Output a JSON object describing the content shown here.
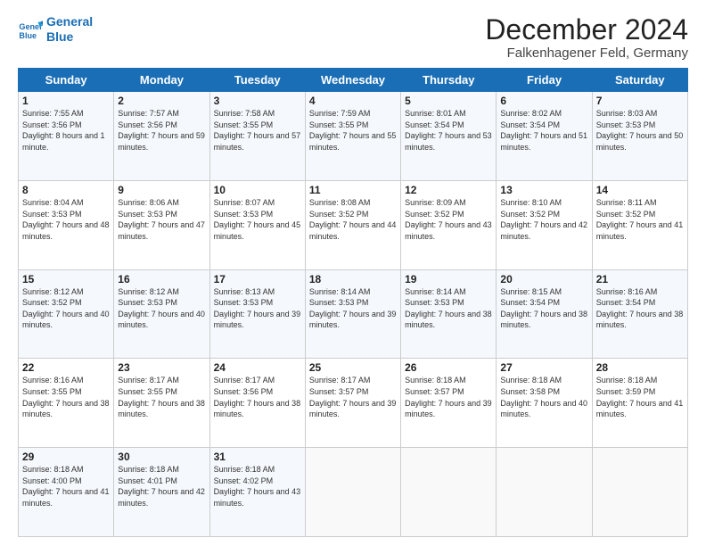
{
  "logo": {
    "line1": "General",
    "line2": "Blue"
  },
  "title": "December 2024",
  "subtitle": "Falkenhagener Feld, Germany",
  "days_header": [
    "Sunday",
    "Monday",
    "Tuesday",
    "Wednesday",
    "Thursday",
    "Friday",
    "Saturday"
  ],
  "weeks": [
    [
      {
        "day": "1",
        "sunrise": "7:55 AM",
        "sunset": "3:56 PM",
        "daylight": "8 hours and 1 minute."
      },
      {
        "day": "2",
        "sunrise": "7:57 AM",
        "sunset": "3:56 PM",
        "daylight": "7 hours and 59 minutes."
      },
      {
        "day": "3",
        "sunrise": "7:58 AM",
        "sunset": "3:55 PM",
        "daylight": "7 hours and 57 minutes."
      },
      {
        "day": "4",
        "sunrise": "7:59 AM",
        "sunset": "3:55 PM",
        "daylight": "7 hours and 55 minutes."
      },
      {
        "day": "5",
        "sunrise": "8:01 AM",
        "sunset": "3:54 PM",
        "daylight": "7 hours and 53 minutes."
      },
      {
        "day": "6",
        "sunrise": "8:02 AM",
        "sunset": "3:54 PM",
        "daylight": "7 hours and 51 minutes."
      },
      {
        "day": "7",
        "sunrise": "8:03 AM",
        "sunset": "3:53 PM",
        "daylight": "7 hours and 50 minutes."
      }
    ],
    [
      {
        "day": "8",
        "sunrise": "8:04 AM",
        "sunset": "3:53 PM",
        "daylight": "7 hours and 48 minutes."
      },
      {
        "day": "9",
        "sunrise": "8:06 AM",
        "sunset": "3:53 PM",
        "daylight": "7 hours and 47 minutes."
      },
      {
        "day": "10",
        "sunrise": "8:07 AM",
        "sunset": "3:53 PM",
        "daylight": "7 hours and 45 minutes."
      },
      {
        "day": "11",
        "sunrise": "8:08 AM",
        "sunset": "3:52 PM",
        "daylight": "7 hours and 44 minutes."
      },
      {
        "day": "12",
        "sunrise": "8:09 AM",
        "sunset": "3:52 PM",
        "daylight": "7 hours and 43 minutes."
      },
      {
        "day": "13",
        "sunrise": "8:10 AM",
        "sunset": "3:52 PM",
        "daylight": "7 hours and 42 minutes."
      },
      {
        "day": "14",
        "sunrise": "8:11 AM",
        "sunset": "3:52 PM",
        "daylight": "7 hours and 41 minutes."
      }
    ],
    [
      {
        "day": "15",
        "sunrise": "8:12 AM",
        "sunset": "3:52 PM",
        "daylight": "7 hours and 40 minutes."
      },
      {
        "day": "16",
        "sunrise": "8:12 AM",
        "sunset": "3:53 PM",
        "daylight": "7 hours and 40 minutes."
      },
      {
        "day": "17",
        "sunrise": "8:13 AM",
        "sunset": "3:53 PM",
        "daylight": "7 hours and 39 minutes."
      },
      {
        "day": "18",
        "sunrise": "8:14 AM",
        "sunset": "3:53 PM",
        "daylight": "7 hours and 39 minutes."
      },
      {
        "day": "19",
        "sunrise": "8:14 AM",
        "sunset": "3:53 PM",
        "daylight": "7 hours and 38 minutes."
      },
      {
        "day": "20",
        "sunrise": "8:15 AM",
        "sunset": "3:54 PM",
        "daylight": "7 hours and 38 minutes."
      },
      {
        "day": "21",
        "sunrise": "8:16 AM",
        "sunset": "3:54 PM",
        "daylight": "7 hours and 38 minutes."
      }
    ],
    [
      {
        "day": "22",
        "sunrise": "8:16 AM",
        "sunset": "3:55 PM",
        "daylight": "7 hours and 38 minutes."
      },
      {
        "day": "23",
        "sunrise": "8:17 AM",
        "sunset": "3:55 PM",
        "daylight": "7 hours and 38 minutes."
      },
      {
        "day": "24",
        "sunrise": "8:17 AM",
        "sunset": "3:56 PM",
        "daylight": "7 hours and 38 minutes."
      },
      {
        "day": "25",
        "sunrise": "8:17 AM",
        "sunset": "3:57 PM",
        "daylight": "7 hours and 39 minutes."
      },
      {
        "day": "26",
        "sunrise": "8:18 AM",
        "sunset": "3:57 PM",
        "daylight": "7 hours and 39 minutes."
      },
      {
        "day": "27",
        "sunrise": "8:18 AM",
        "sunset": "3:58 PM",
        "daylight": "7 hours and 40 minutes."
      },
      {
        "day": "28",
        "sunrise": "8:18 AM",
        "sunset": "3:59 PM",
        "daylight": "7 hours and 41 minutes."
      }
    ],
    [
      {
        "day": "29",
        "sunrise": "8:18 AM",
        "sunset": "4:00 PM",
        "daylight": "7 hours and 41 minutes."
      },
      {
        "day": "30",
        "sunrise": "8:18 AM",
        "sunset": "4:01 PM",
        "daylight": "7 hours and 42 minutes."
      },
      {
        "day": "31",
        "sunrise": "8:18 AM",
        "sunset": "4:02 PM",
        "daylight": "7 hours and 43 minutes."
      },
      null,
      null,
      null,
      null
    ]
  ]
}
